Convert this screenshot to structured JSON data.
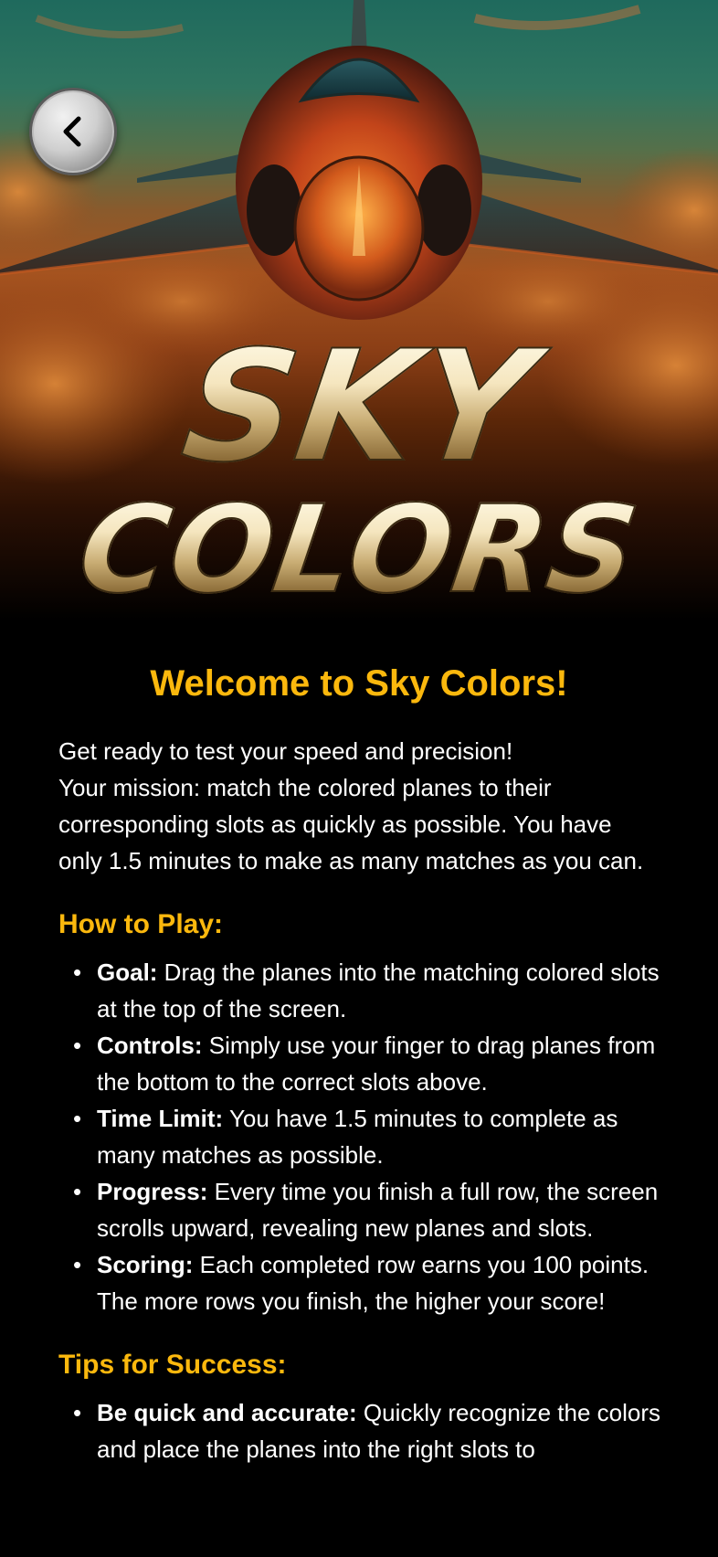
{
  "hero": {
    "logo_line1": "SKY",
    "logo_line2": "COLORS",
    "back_icon": "chevron-left-icon"
  },
  "main": {
    "title": "Welcome to Sky Colors!",
    "intro_line1": "Get ready to test your speed and precision!",
    "intro_line2": "Your mission: match the colored planes to their corresponding slots as quickly as possible. You have only 1.5 minutes to make as many matches as you can.",
    "how_to_play": {
      "heading": "How to Play:",
      "items": [
        {
          "label": "Goal:",
          "text": " Drag the planes into the matching colored slots at the top of the screen."
        },
        {
          "label": "Controls:",
          "text": " Simply use your finger to drag planes from the bottom to the correct slots above."
        },
        {
          "label": "Time Limit:",
          "text": " You have 1.5 minutes to complete as many matches as possible."
        },
        {
          "label": "Progress:",
          "text": " Every time you finish a full row, the screen scrolls upward, revealing new planes and slots."
        },
        {
          "label": "Scoring:",
          "text": " Each completed row earns you 100 points. The more rows you finish, the higher your score!"
        }
      ]
    },
    "tips": {
      "heading": "Tips for Success:",
      "items": [
        {
          "label": "Be quick and accurate:",
          "text": " Quickly recognize the colors and place the planes into the right slots to"
        }
      ]
    }
  },
  "colors": {
    "accent": "#fbb80d",
    "background": "#000000",
    "text": "#ffffff"
  }
}
